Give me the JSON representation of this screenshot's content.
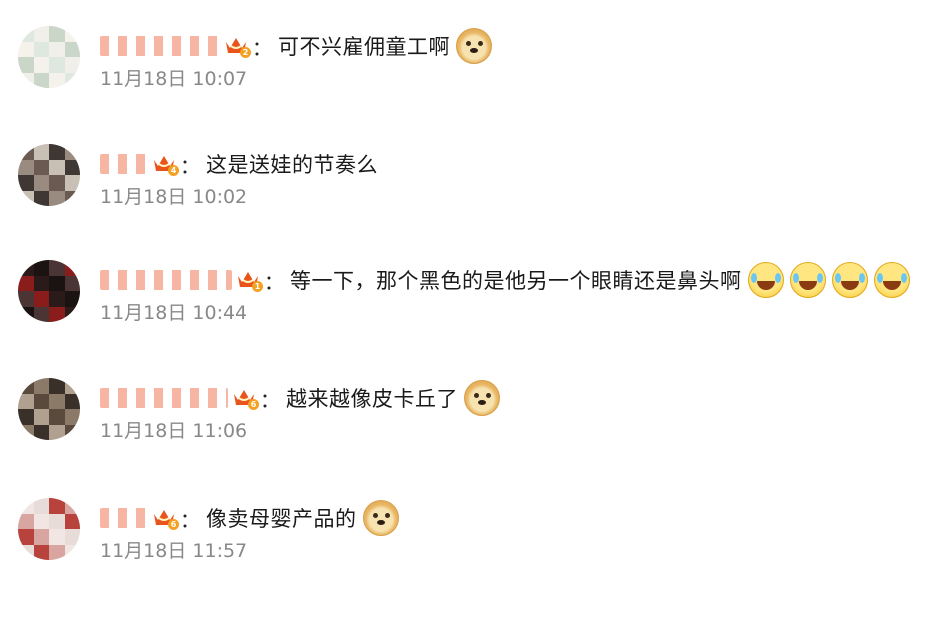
{
  "comments": [
    {
      "level": "2",
      "text": "可不兴雇佣童工啊",
      "emojis": [
        "doge"
      ],
      "time": "11月18日 10:07",
      "avatar_colors": [
        "#dfe8e0",
        "#f5f2ec",
        "#c9d6c8",
        "#f1efe9"
      ]
    },
    {
      "level": "4",
      "text": "这是送娃的节奏么",
      "emojis": [],
      "time": "11月18日 10:02",
      "avatar_colors": [
        "#6b5a52",
        "#9a8b80",
        "#3f3733",
        "#c8bfb5"
      ]
    },
    {
      "level": "1",
      "text": "等一下，那个黑色的是他另一个眼睛还是鼻头啊",
      "emojis": [
        "laugh",
        "laugh",
        "laugh",
        "laugh"
      ],
      "time": "11月18日 10:44",
      "avatar_colors": [
        "#2a1a1a",
        "#8a1c1c",
        "#4a3434",
        "#1b1212"
      ]
    },
    {
      "level": "6",
      "text": "越来越像皮卡丘了",
      "emojis": [
        "doge"
      ],
      "time": "11月18日 11:06",
      "avatar_colors": [
        "#5a4a3e",
        "#b0a090",
        "#3a302a",
        "#8c7a68"
      ]
    },
    {
      "level": "6",
      "text": "像卖母婴产品的",
      "emojis": [
        "doge"
      ],
      "time": "11月18日 11:57",
      "avatar_colors": [
        "#f1e6e4",
        "#d9a5a0",
        "#b8423c",
        "#e8dcd8"
      ]
    }
  ],
  "icons": {
    "crown": "crown-badge-icon",
    "doge": "doge-emoji-icon",
    "laugh": "laugh-cry-emoji-icon"
  },
  "colors": {
    "text": "#1a1a1a",
    "time": "#888888",
    "crown": "#e8541a",
    "badge": "#f4a020"
  }
}
